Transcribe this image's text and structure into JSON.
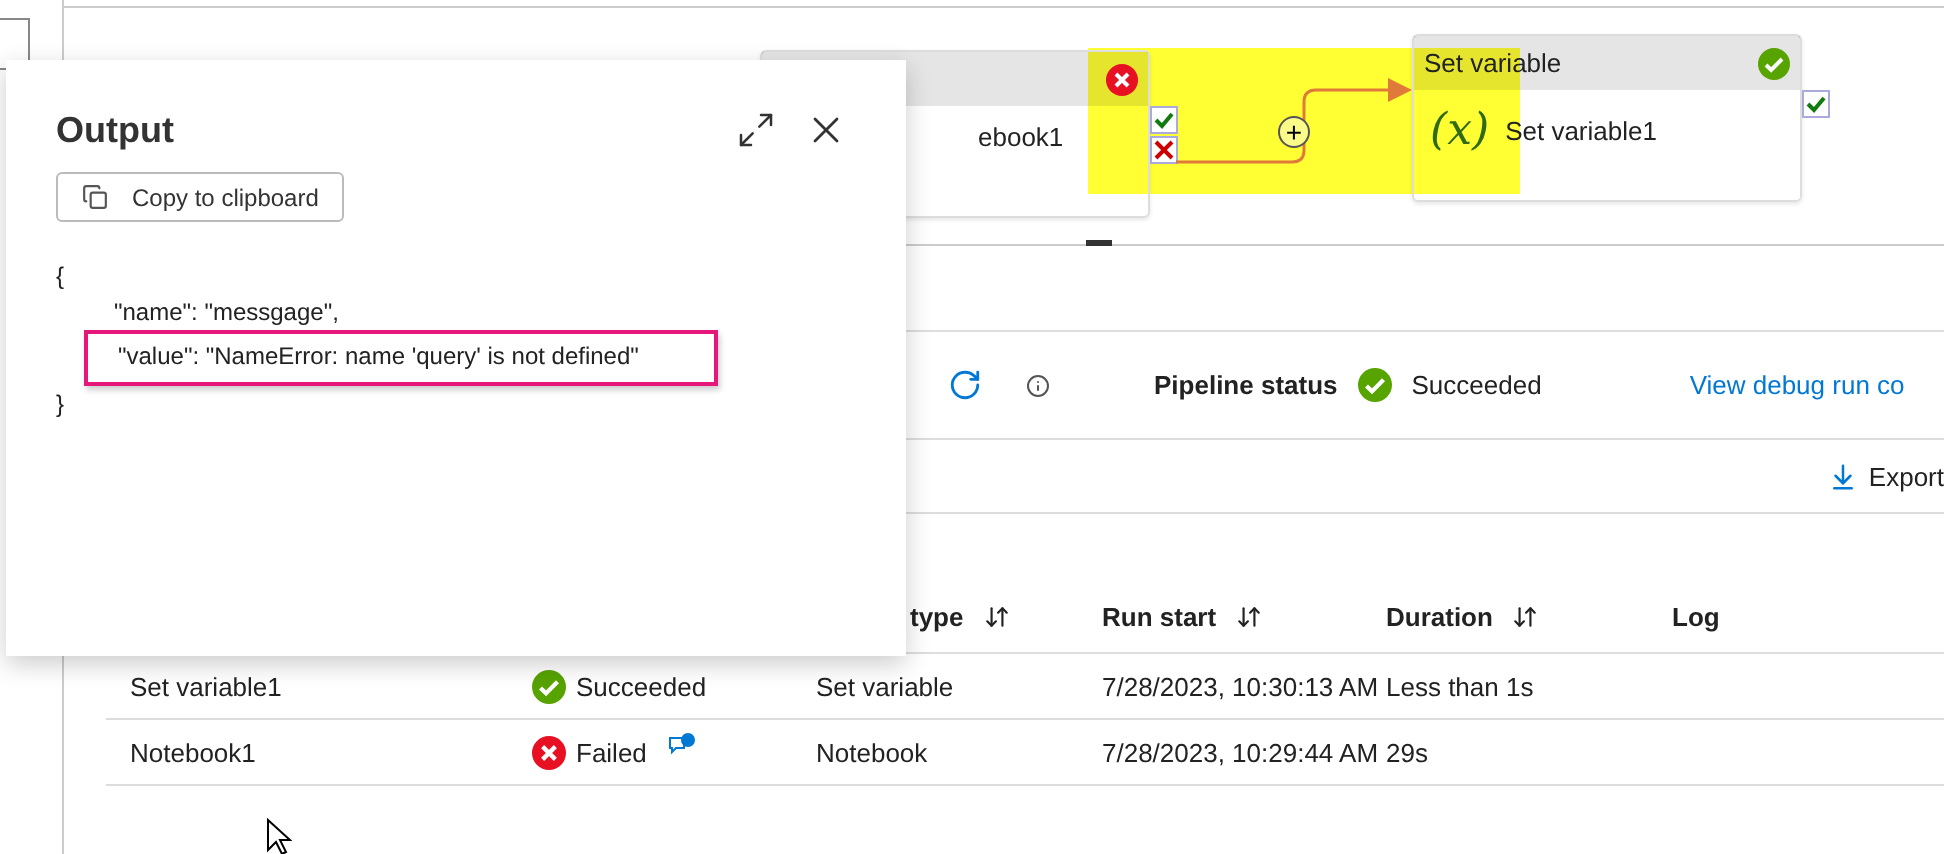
{
  "canvas": {
    "activities": [
      {
        "kind": "notebook",
        "name": "ebook1",
        "succeeded": false,
        "ports": [
          {
            "kind": "success"
          },
          {
            "kind": "failure"
          }
        ]
      },
      {
        "kind": "set_variable",
        "title": "Set variable",
        "icon_glyph": "(x)",
        "name": "Set variable1",
        "succeeded": true,
        "ports": [
          {
            "kind": "success"
          }
        ]
      }
    ],
    "add_glyph": "+"
  },
  "status_bar": {
    "label": "Pipeline status",
    "succeeded": true,
    "status_text": "Succeeded",
    "link": "View debug run co"
  },
  "export_button": "Export",
  "table": {
    "columns": [
      {
        "label": "type",
        "sortable": true
      },
      {
        "label": "Run start",
        "sortable": true
      },
      {
        "label": "Duration",
        "sortable": true
      },
      {
        "label": "Log",
        "sortable": false
      }
    ],
    "rows": [
      {
        "name": "Set variable1",
        "succeeded": true,
        "status_text": "Succeeded",
        "type": "Set variable",
        "run_start": "7/28/2023, 10:30:13 AM",
        "duration": "Less than 1s",
        "has_error_details": false
      },
      {
        "name": "Notebook1",
        "succeeded": false,
        "status_text": "Failed",
        "type": "Notebook",
        "run_start": "7/28/2023, 10:29:44 AM",
        "duration": "29s",
        "has_error_details": true
      }
    ]
  },
  "output_dialog": {
    "title": "Output",
    "copy_button": "Copy to clipboard",
    "lines": [
      {
        "text": "{",
        "indented": false,
        "highlighted": false
      },
      {
        "text": "\"name\": \"messgage\",",
        "indented": true,
        "highlighted": false
      },
      {
        "text": "\"value\": \"NameError: name 'query' is not defined\"",
        "indented": true,
        "highlighted": true
      },
      {
        "text": "}",
        "indented": false,
        "highlighted": false
      }
    ]
  }
}
